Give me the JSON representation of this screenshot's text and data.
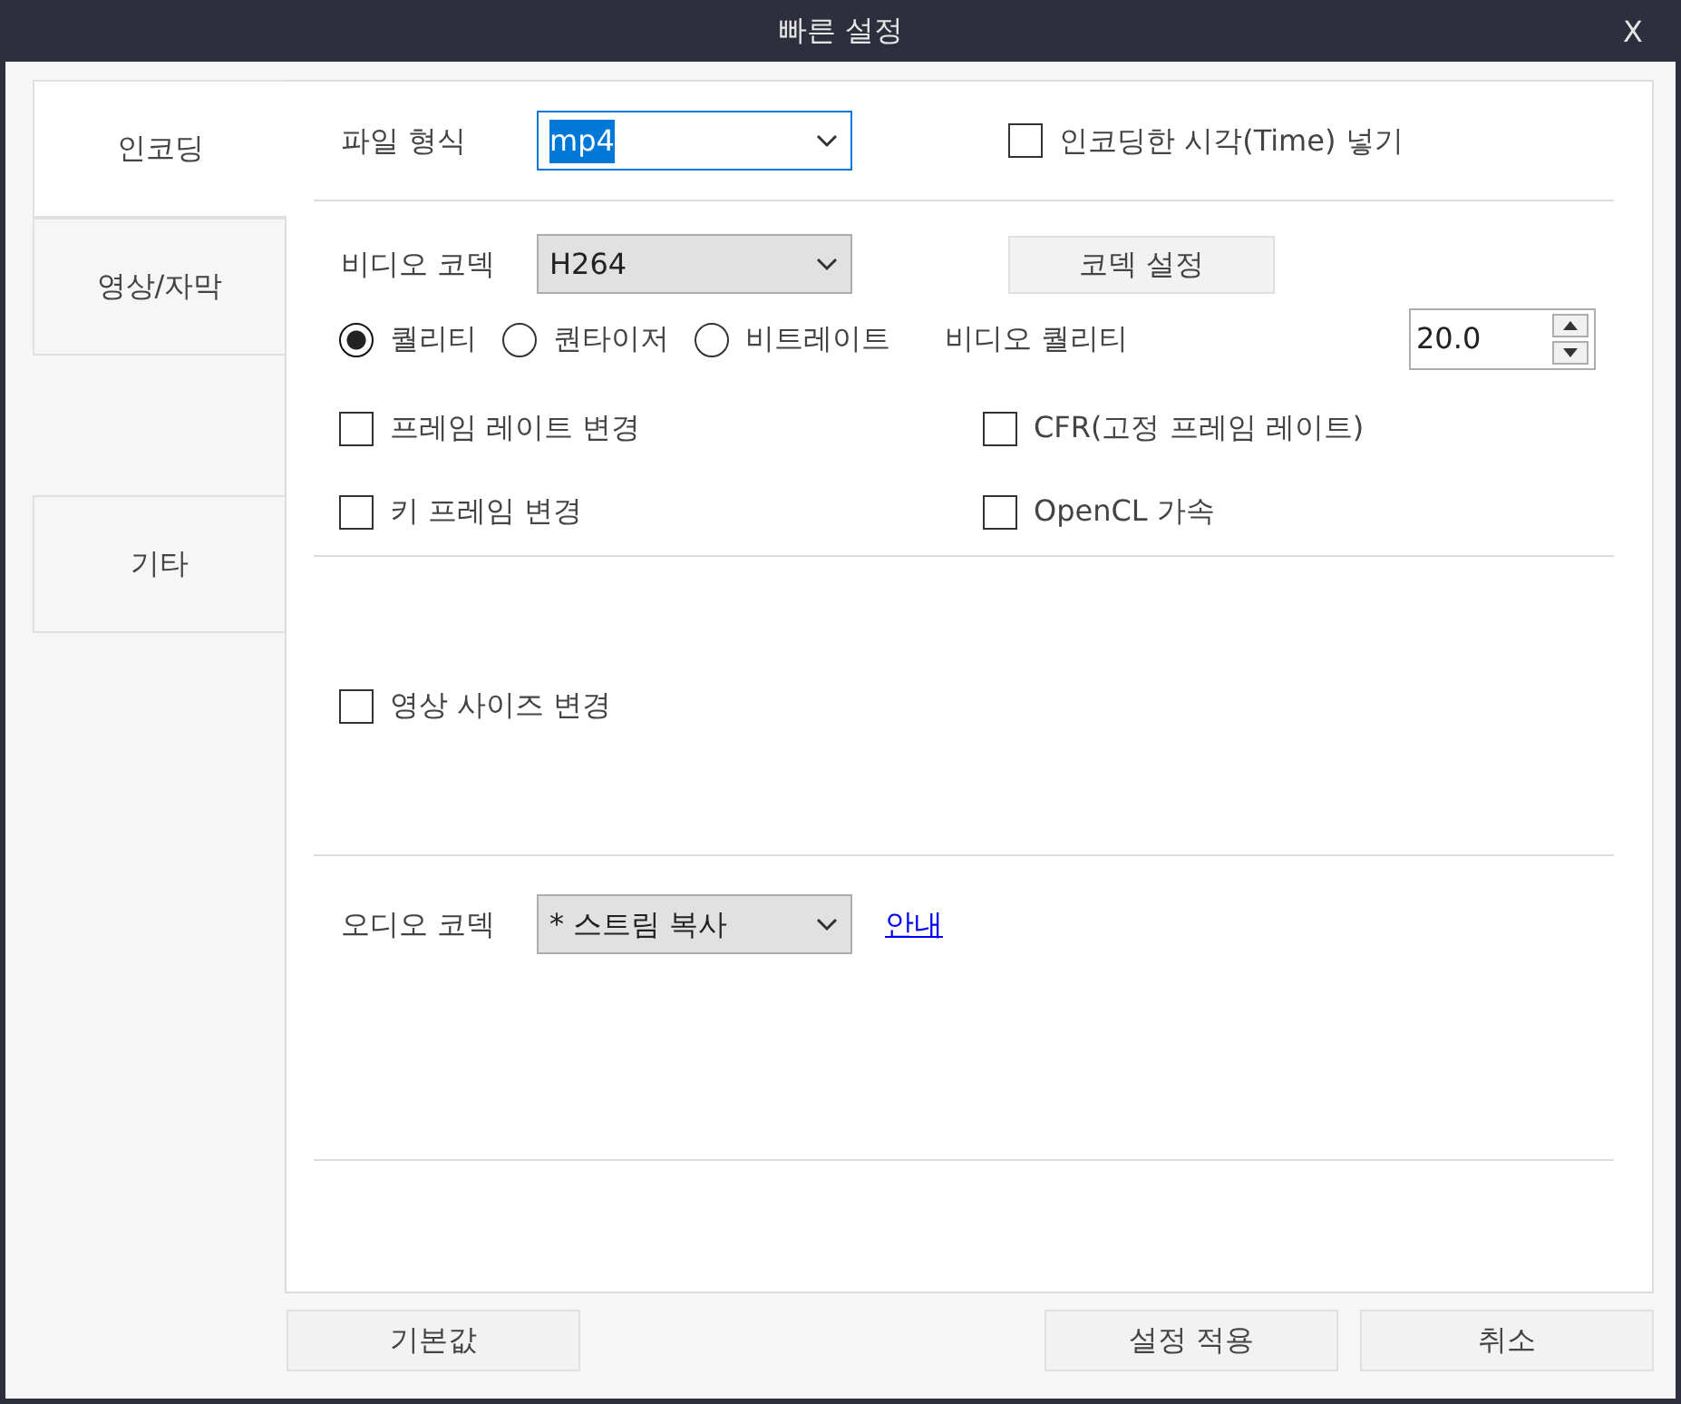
{
  "window": {
    "title": "빠른 설정",
    "close": "X"
  },
  "tabs": [
    {
      "label": "인코딩",
      "selected": true
    },
    {
      "label": "영상/자막",
      "selected": false
    },
    {
      "label": "기타",
      "selected": false
    }
  ],
  "file_format": {
    "label": "파일 형식",
    "value": "mp4",
    "focused": true
  },
  "insert_time": {
    "label": "인코딩한 시각(Time) 넣기",
    "checked": false
  },
  "video_codec": {
    "label": "비디오 코덱",
    "value": "H264"
  },
  "codec_settings_button": "코덱 설정",
  "rate_modes": [
    {
      "label": "퀄리티",
      "selected": true
    },
    {
      "label": "퀀타이저",
      "selected": false
    },
    {
      "label": "비트레이트",
      "selected": false
    }
  ],
  "video_quality": {
    "label": "비디오 퀄리티",
    "value": "20.0"
  },
  "video_options": [
    {
      "label": "프레임 레이트 변경",
      "checked": false
    },
    {
      "label": "CFR(고정 프레임 레이트)",
      "checked": false
    },
    {
      "label": "키 프레임 변경",
      "checked": false
    },
    {
      "label": "OpenCL 가속",
      "checked": false
    }
  ],
  "resize": {
    "label": "영상 사이즈 변경",
    "checked": false
  },
  "audio_codec": {
    "label": "오디오 코덱",
    "value": "* 스트림 복사"
  },
  "guide_link": "안내",
  "buttons": {
    "defaults": "기본값",
    "apply": "설정 적용",
    "cancel": "취소"
  }
}
